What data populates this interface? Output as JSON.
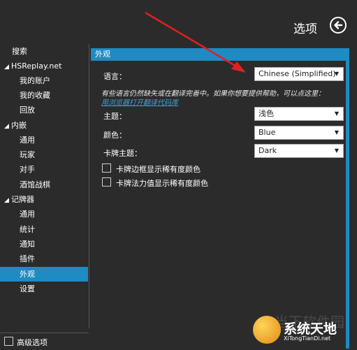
{
  "header": {
    "title": "选项"
  },
  "sidebar": {
    "items": [
      {
        "label": "搜索",
        "level": 0,
        "expandable": false,
        "selected": false
      },
      {
        "label": "HSReplay.net",
        "level": 0,
        "expandable": true,
        "selected": false
      },
      {
        "label": "我的账户",
        "level": 1,
        "expandable": false,
        "selected": false
      },
      {
        "label": "我的收藏",
        "level": 1,
        "expandable": false,
        "selected": false
      },
      {
        "label": "回放",
        "level": 1,
        "expandable": false,
        "selected": false
      },
      {
        "label": "内嵌",
        "level": 0,
        "expandable": true,
        "selected": false
      },
      {
        "label": "通用",
        "level": 1,
        "expandable": false,
        "selected": false
      },
      {
        "label": "玩家",
        "level": 1,
        "expandable": false,
        "selected": false
      },
      {
        "label": "对手",
        "level": 1,
        "expandable": false,
        "selected": false
      },
      {
        "label": "酒馆战棋",
        "level": 1,
        "expandable": false,
        "selected": false
      },
      {
        "label": "记牌器",
        "level": 0,
        "expandable": true,
        "selected": false
      },
      {
        "label": "通用",
        "level": 1,
        "expandable": false,
        "selected": false
      },
      {
        "label": "统计",
        "level": 1,
        "expandable": false,
        "selected": false
      },
      {
        "label": "通知",
        "level": 1,
        "expandable": false,
        "selected": false
      },
      {
        "label": "插件",
        "level": 1,
        "expandable": false,
        "selected": false
      },
      {
        "label": "外观",
        "level": 1,
        "expandable": false,
        "selected": true
      },
      {
        "label": "设置",
        "level": 1,
        "expandable": false,
        "selected": false
      }
    ],
    "advanced_label": "高级选项"
  },
  "panel": {
    "title": "外观",
    "language": {
      "label": "语言：",
      "value": "Chinese (Simplified)"
    },
    "note": "有些语言仍然缺失或在翻译完善中。如果你想要提供帮助，可以点这里：",
    "link": "用浏览器打开翻译代码库",
    "theme": {
      "label": "主题：",
      "value": "浅色"
    },
    "color": {
      "label": "颜色：",
      "value": "Blue"
    },
    "card_theme": {
      "label": "卡牌主题：",
      "value": "Dark"
    },
    "checkbox1": "卡牌边框显示稀有度颜色",
    "checkbox2": "卡牌法力值显示稀有度颜色"
  },
  "watermark": "当下软件园",
  "logo": {
    "title": "系统天地",
    "subtitle": "XiTongTianDi.net"
  },
  "colors": {
    "accent": "#1e8bc3",
    "background": "#2b2b2b",
    "arrow": "#e02020"
  }
}
